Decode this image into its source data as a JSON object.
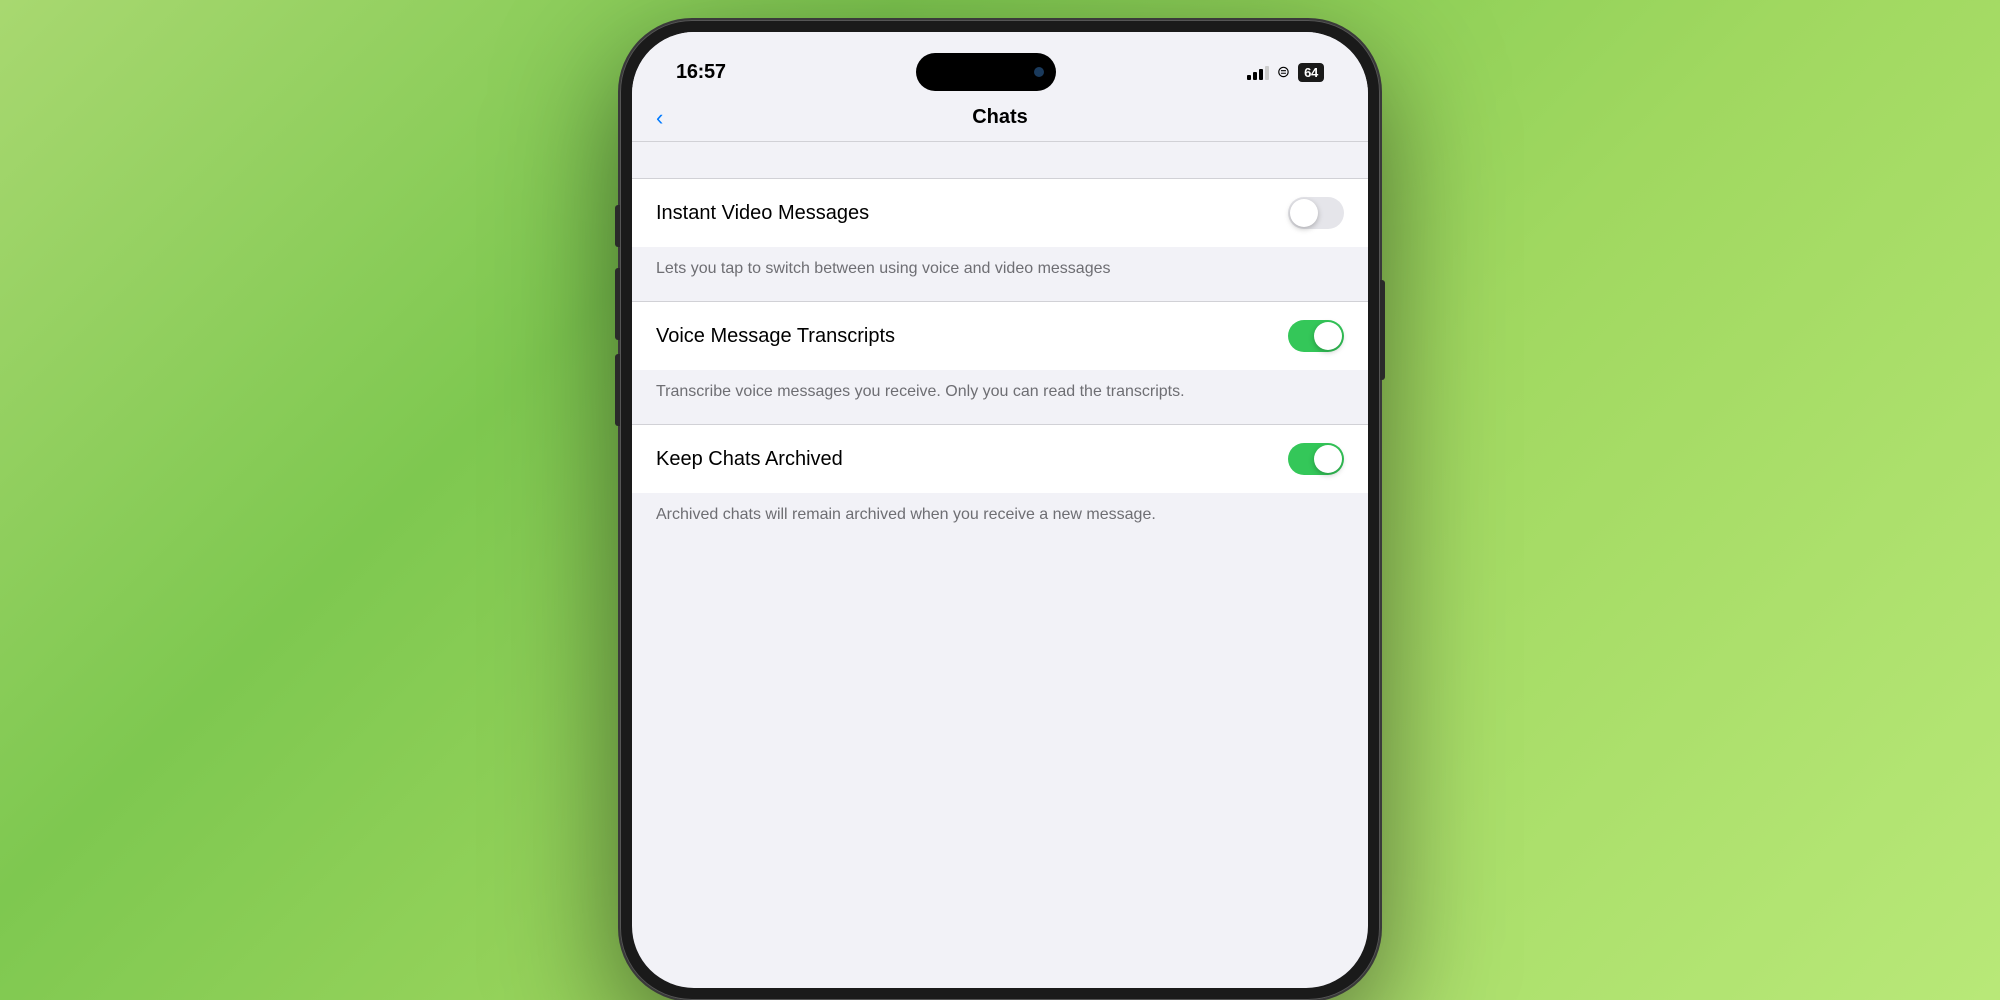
{
  "statusBar": {
    "time": "16:57",
    "battery": "64"
  },
  "navBar": {
    "backLabel": "‹",
    "title": "Chats"
  },
  "settings": {
    "instantVideoMessages": {
      "label": "Instant Video Messages",
      "description": "Lets you tap to switch between using voice and video messages",
      "enabled": false
    },
    "voiceMessageTranscripts": {
      "label": "Voice Message Transcripts",
      "description": "Transcribe voice messages you receive. Only you can read the transcripts.",
      "enabled": true
    },
    "keepChatsArchived": {
      "label": "Keep Chats Archived",
      "description": "Archived chats will remain archived when you receive a new message.",
      "enabled": true
    }
  }
}
